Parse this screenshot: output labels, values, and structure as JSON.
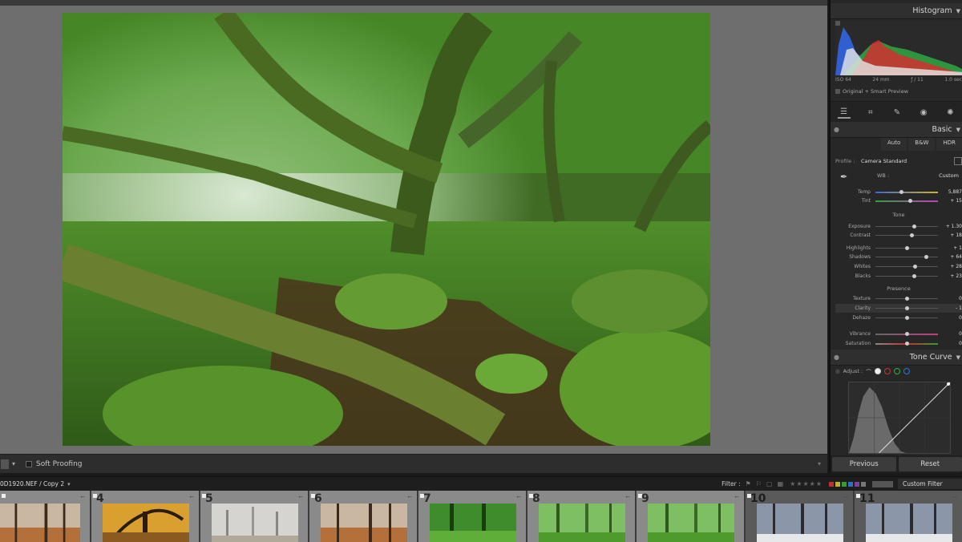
{
  "toolbar": {
    "soft_proofing_label": "Soft Proofing"
  },
  "panel": {
    "histogram_title": "Histogram",
    "exif": {
      "iso": "ISO 64",
      "focal": "24 mm",
      "aperture": "ƒ / 11",
      "shutter": "1.0 sec"
    },
    "preview_note": "Original + Smart Preview",
    "basic_title": "Basic",
    "treatment": [
      "Auto",
      "B&W",
      "HDR"
    ],
    "profile_label": "Profile :",
    "profile_value": "Camera Standard",
    "wb_label": "WB :",
    "wb_value": "Custom",
    "tone_label": "Tone",
    "presence_label": "Presence",
    "sliders": [
      {
        "label": "Temp",
        "value": "5,887",
        "pos": 0.42
      },
      {
        "label": "Tint",
        "value": "+ 15",
        "pos": 0.56
      },
      {
        "label": "Exposure",
        "value": "+ 1.30",
        "pos": 0.62
      },
      {
        "label": "Contrast",
        "value": "+ 18",
        "pos": 0.58
      },
      {
        "label": "Highlights",
        "value": "+ 1",
        "pos": 0.5
      },
      {
        "label": "Shadows",
        "value": "+ 64",
        "pos": 0.82
      },
      {
        "label": "Whites",
        "value": "+ 28",
        "pos": 0.64
      },
      {
        "label": "Blacks",
        "value": "+ 23",
        "pos": 0.62
      },
      {
        "label": "Texture",
        "value": "0",
        "pos": 0.5
      },
      {
        "label": "Clarity",
        "value": "- 1",
        "pos": 0.5
      },
      {
        "label": "Dehaze",
        "value": "0",
        "pos": 0.5
      },
      {
        "label": "Vibrance",
        "value": "0",
        "pos": 0.5
      },
      {
        "label": "Saturation",
        "value": "0",
        "pos": 0.5
      }
    ],
    "tone_curve_title": "Tone Curve",
    "adjust_label": "Adjust :",
    "previous_label": "Previous",
    "reset_label": "Reset"
  },
  "filmstrip": {
    "file_name": "0D1920.NEF / Copy 2",
    "filter_label": "Filter :",
    "stars": "★★★★★",
    "custom_filter": "Custom Filter",
    "colors": [
      "#c03030",
      "#c0b030",
      "#30a030",
      "#3070c0",
      "#8040a0",
      "#777777"
    ],
    "cells": [
      {
        "num": "",
        "scene": "autumn"
      },
      {
        "num": "4",
        "scene": "autumn-gold"
      },
      {
        "num": "5",
        "scene": "mist"
      },
      {
        "num": "6",
        "scene": "autumn"
      },
      {
        "num": "7",
        "scene": "green"
      },
      {
        "num": "8",
        "scene": "green-mist"
      },
      {
        "num": "9",
        "scene": "green-mist"
      },
      {
        "num": "10",
        "scene": "winter"
      },
      {
        "num": "11",
        "scene": "winter"
      }
    ]
  }
}
